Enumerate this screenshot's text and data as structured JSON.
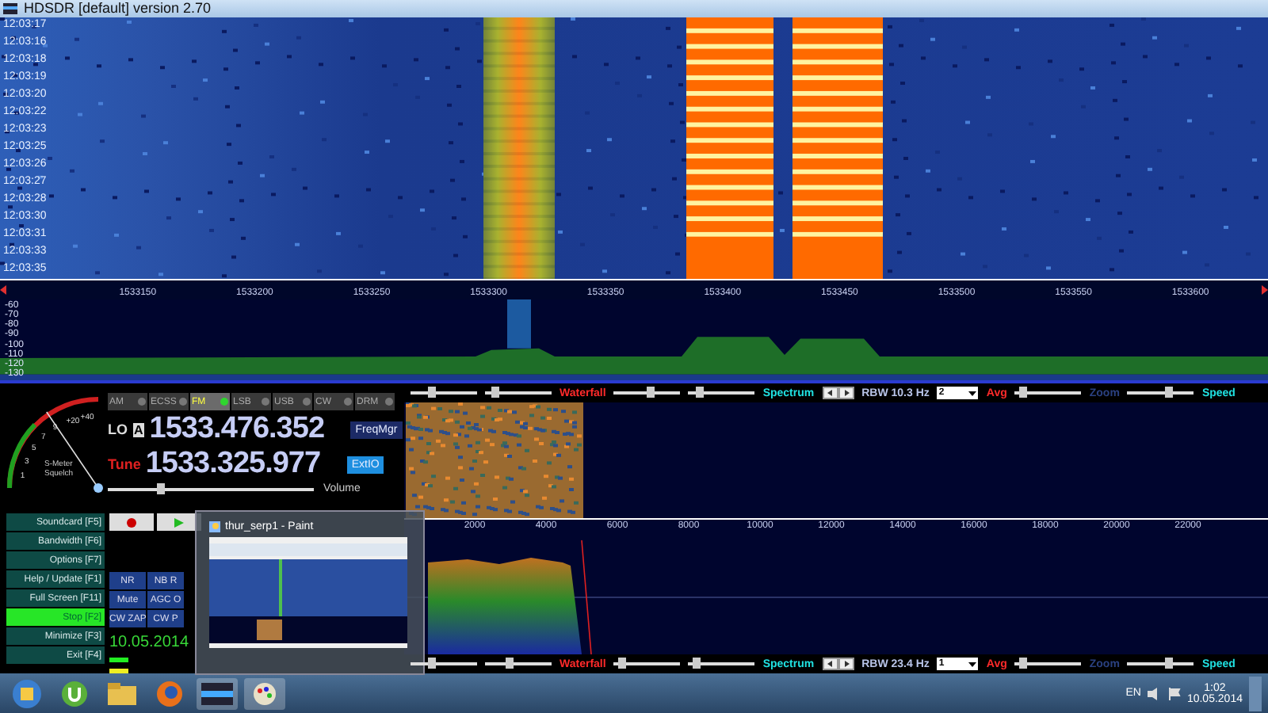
{
  "window": {
    "title": "HDSDR [default]  version 2.70"
  },
  "waterfall": {
    "time_labels": [
      "12:03:17",
      "12:03:16",
      "12:03:18",
      "12:03:19",
      "12:03:20",
      "12:03:22",
      "12:03:23",
      "12:03:25",
      "12:03:26",
      "12:03:27",
      "12:03:28",
      "12:03:30",
      "12:03:31",
      "12:03:33",
      "12:03:35"
    ]
  },
  "frequency_axis": {
    "labels": [
      "1533150",
      "1533200",
      "1533250",
      "1533300",
      "1533350",
      "1533400",
      "1533450",
      "1533500",
      "1533550",
      "1533600"
    ]
  },
  "spectrum": {
    "db_labels": [
      "-60",
      "-70",
      "-80",
      "-90",
      "-100",
      "-110",
      "-120",
      "-130"
    ]
  },
  "smeter": {
    "scale": [
      "+40",
      "+20",
      "9",
      "7",
      "5",
      "3",
      "1"
    ],
    "caption": "S-Meter",
    "squelch": "Squelch",
    "level": 0.62
  },
  "modes": [
    {
      "label": "AM",
      "selected": false
    },
    {
      "label": "ECSS",
      "selected": false
    },
    {
      "label": "FM",
      "selected": true
    },
    {
      "label": "LSB",
      "selected": false
    },
    {
      "label": "USB",
      "selected": false
    },
    {
      "label": "CW",
      "selected": false
    },
    {
      "label": "DRM",
      "selected": false
    }
  ],
  "lo": {
    "label": "LO",
    "vfo": "A",
    "value": "1533.476.352"
  },
  "tune": {
    "label": "Tune",
    "value": "1533.325.977"
  },
  "receiver_buttons": [
    "FreqMgr",
    "ExtIO"
  ],
  "volume": {
    "label": "Volume",
    "level": 0.25
  },
  "side_buttons": [
    {
      "label": "Soundcard [F5]",
      "selected": false
    },
    {
      "label": "Bandwidth [F6]",
      "selected": false
    },
    {
      "label": "Options [F7]",
      "selected": false
    },
    {
      "label": "Help / Update [F1]",
      "selected": false
    },
    {
      "label": "Full Screen [F11]",
      "selected": false
    },
    {
      "label": "Stop [F2]",
      "selected": true
    },
    {
      "label": "Minimize [F3]",
      "selected": false
    },
    {
      "label": "Exit [F4]",
      "selected": false
    }
  ],
  "dsp_buttons": [
    "NR",
    "NB R",
    "Mute",
    "AGC O",
    "CW ZAP",
    "CW P"
  ],
  "date": "10.05.2014",
  "popup": {
    "title": "thur_serp1 - Paint"
  },
  "audio_bars": [
    {
      "waterfall": "Waterfall",
      "spectrum": "Spectrum",
      "rbw": "RBW 10.3 Hz",
      "avg_value": "2",
      "avg": "Avg",
      "zoom": "Zoom",
      "speed": "Speed",
      "sliders": [
        {
          "level": 0.3
        },
        {
          "level": 0.15
        },
        {
          "level": 0.55
        },
        {
          "level": 0.15
        },
        {
          "level": 0.1
        },
        {
          "level": 0.6
        }
      ]
    },
    {
      "waterfall": "Waterfall",
      "spectrum": "Spectrum",
      "rbw": "RBW 23.4 Hz",
      "avg_value": "1",
      "avg": "Avg",
      "zoom": "Zoom",
      "speed": "Speed",
      "sliders": [
        {
          "level": 0.3
        },
        {
          "level": 0.35
        },
        {
          "level": 0.1
        },
        {
          "level": 0.1
        },
        {
          "level": 0.12
        },
        {
          "level": 0.6
        }
      ]
    }
  ],
  "audio_axis": {
    "labels": [
      "2000",
      "4000",
      "6000",
      "8000",
      "10000",
      "12000",
      "14000",
      "16000",
      "18000",
      "20000",
      "22000"
    ]
  },
  "taskbar": {
    "language": "EN",
    "time": "1:02",
    "date": "10.05.2014"
  }
}
